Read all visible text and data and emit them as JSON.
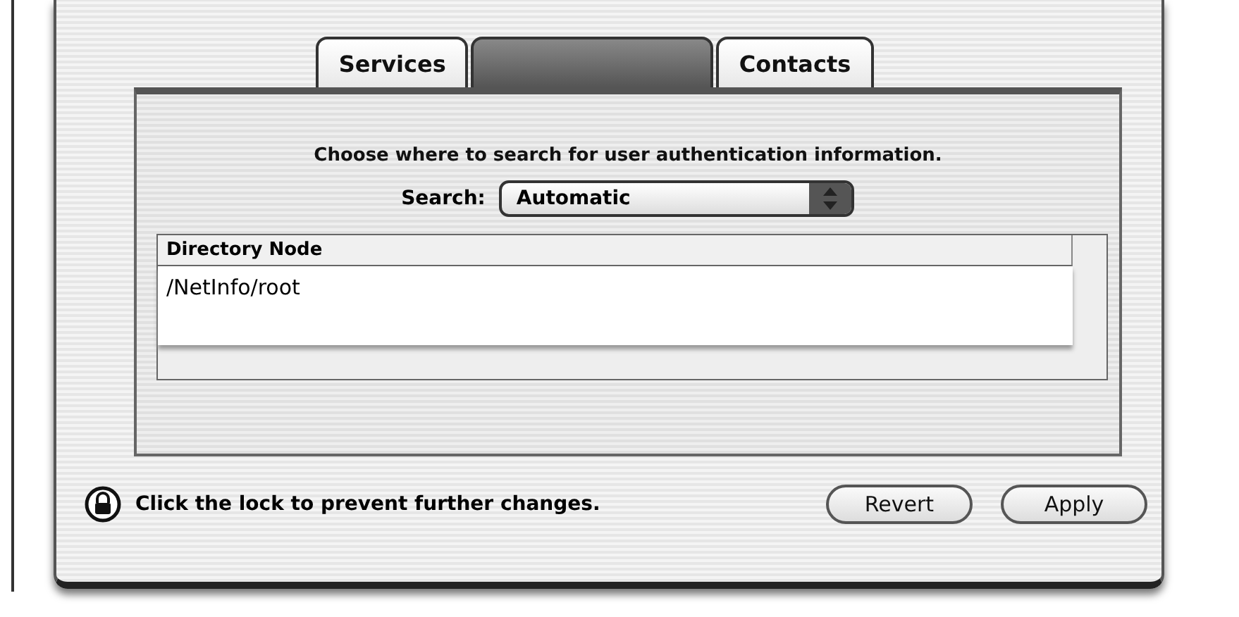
{
  "tabs": [
    {
      "label": "Services",
      "selected": false
    },
    {
      "selected": true
    },
    {
      "label": "Contacts",
      "selected": false
    }
  ],
  "instruction": "Choose where to search for user authentication information.",
  "search": {
    "label": "Search:",
    "value": "Automatic"
  },
  "table": {
    "columns": [
      "Directory Node"
    ],
    "rows": [
      [
        "/NetInfo/root"
      ]
    ]
  },
  "lock": {
    "text": "Click the lock to prevent further changes."
  },
  "buttons": [
    "Revert",
    "Apply"
  ]
}
